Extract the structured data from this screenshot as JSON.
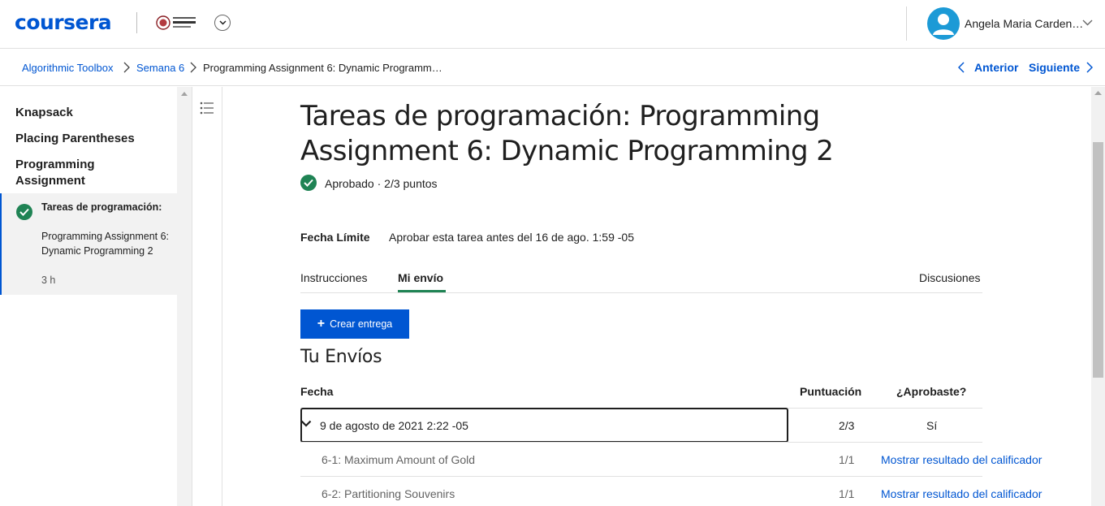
{
  "header": {
    "logo_text": "coursera",
    "user_name": "Angela Maria Carden…"
  },
  "breadcrumb": {
    "items": [
      "Algorithmic Toolbox",
      "Semana 6",
      "Programming Assignment 6: Dynamic Programm…"
    ],
    "prev_label": "Anterior",
    "next_label": "Siguiente"
  },
  "sidebar": {
    "headings": [
      "Knapsack",
      "Placing Parentheses",
      "Programming Assignment"
    ],
    "active_item": {
      "title": "Tareas de programación:",
      "body": "Programming Assignment 6: Dynamic Programming 2",
      "duration": "3 h"
    }
  },
  "main": {
    "title": "Tareas de programación: Programming Assignment 6: Dynamic Programming 2",
    "status": "Aprobado · 2/3 puntos",
    "deadline_label": "Fecha Límite",
    "deadline_value": "Aprobar esta tarea antes del 16 de ago. 1:59 -05",
    "tabs": [
      "Instrucciones",
      "Mi envío",
      "Discusiones"
    ],
    "active_tab": "Mi envío",
    "create_button": "Crear entrega",
    "section_title": "Tu Envíos",
    "table": {
      "headers": [
        "Fecha",
        "Puntuación",
        "¿Aprobaste?"
      ],
      "submission": {
        "date": "9 de agosto de 2021 2:22 -05",
        "score": "2/3",
        "passed": "Sí"
      },
      "parts": [
        {
          "name": "6-1: Maximum Amount of Gold",
          "score": "1/1",
          "link": "Mostrar resultado del calificador"
        },
        {
          "name": "6-2: Partitioning Souvenirs",
          "score": "1/1",
          "link": "Mostrar resultado del calificador"
        }
      ]
    }
  },
  "colors": {
    "brand_blue": "#0056d2",
    "success_green": "#1f8354",
    "avatar_blue": "#1c9ad6"
  },
  "icons": [
    "chevron-down-icon",
    "user-avatar-icon",
    "chevron-right-icon",
    "chevron-left-icon",
    "check-circle-icon",
    "list-icon",
    "plus-icon"
  ]
}
